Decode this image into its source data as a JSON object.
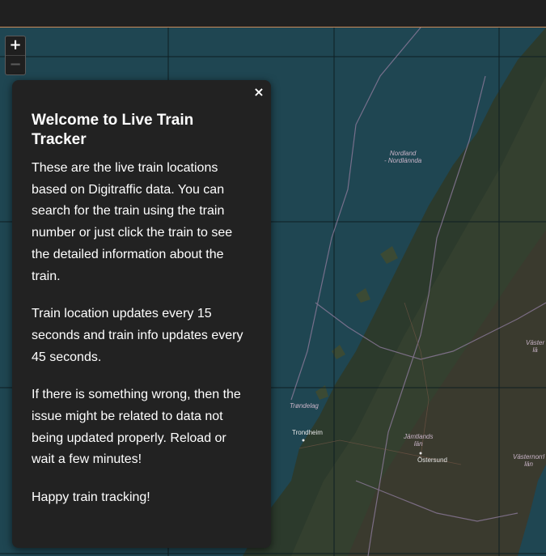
{
  "zoom": {
    "in_label": "+",
    "out_label": "−"
  },
  "map": {
    "labels": {
      "nordland": "Nordland\n- Nordlánnda",
      "trondelag": "Trøndelag",
      "trondheim": "Trondheim",
      "jamtlands": "Jämtlands\nlän",
      "ostersund": "Östersund",
      "vasterbotten": "Väster\nlä",
      "vasternorrland": "Västernorrl\nlän"
    }
  },
  "modal": {
    "close_label": "×",
    "title": "Welcome to Live Train Tracker",
    "paragraphs": [
      "These are the live train locations based on Digitraffic data. You can search for the train using the train number or just click the train to see the detailed information about the train.",
      "Train location updates every 15 seconds and train info updates every 45 seconds.",
      "If there is something wrong, then the issue might be related to data not being updated properly. Reload or wait a few minutes!",
      "Happy train tracking!"
    ]
  }
}
